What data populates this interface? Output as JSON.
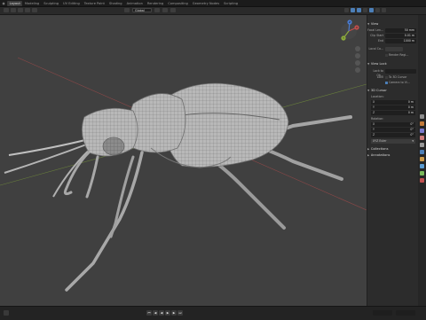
{
  "app": {
    "name": "Blender"
  },
  "workspaces": [
    "Layout",
    "Modeling",
    "Sculpting",
    "UV Editing",
    "Texture Paint",
    "Shading",
    "Animation",
    "Rendering",
    "Compositing",
    "Geometry Nodes",
    "Scripting"
  ],
  "header": {
    "orientation": "Global",
    "options_label": "Options"
  },
  "npanel": {
    "tabs": [
      "Options"
    ],
    "view": {
      "title": "View",
      "focal_length": {
        "label": "Focal Len...",
        "value": "50 mm"
      },
      "clip_start": {
        "label": "Clip Start",
        "value": "0.01 m"
      },
      "clip_end": {
        "label": "End",
        "value": "1000 m"
      },
      "local_camera": {
        "label": "Local Ca..."
      },
      "render_region": {
        "label": "Render Regi..."
      }
    },
    "view_lock": {
      "title": "View Lock",
      "lock_to_object": {
        "label": "Lock to Ob..."
      },
      "lock_label": "Lock",
      "to_cursor": {
        "label": "To 3D Cursor"
      },
      "camera_to_view": {
        "label": "Camera to Vi..."
      }
    },
    "cursor": {
      "title": "3D Cursor",
      "location_label": "Location:",
      "location": [
        {
          "axis": "X",
          "value": "0 m"
        },
        {
          "axis": "Y",
          "value": "0 m"
        },
        {
          "axis": "Z",
          "value": "0 m"
        }
      ],
      "rotation_label": "Rotation:",
      "rotation": [
        {
          "axis": "X",
          "value": "0°"
        },
        {
          "axis": "Y",
          "value": "0°"
        },
        {
          "axis": "Z",
          "value": "0°"
        }
      ],
      "rotation_mode": "XYZ Euler"
    },
    "collections": {
      "title": "Collections"
    },
    "annotations": {
      "title": "Annotations"
    }
  },
  "colors": {
    "accent": "#4c7fb8",
    "viewport_bg": "#404040",
    "x_axis": "#c0504d",
    "y_axis": "#8cab3c",
    "z_axis": "#4a7bd0"
  },
  "gizmo": {
    "x_label": "X",
    "y_label": "Y",
    "z_label": "Z"
  }
}
